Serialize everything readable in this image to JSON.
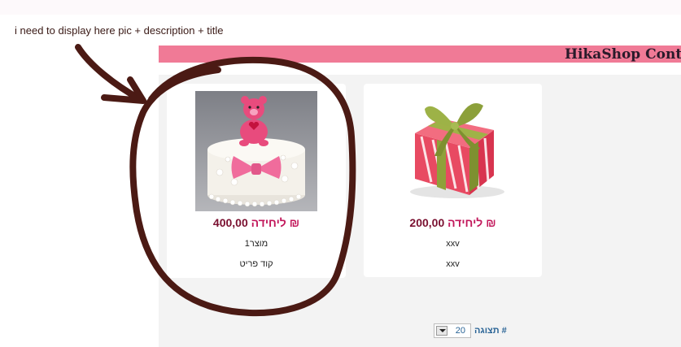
{
  "annotation": {
    "note": "i need to display here pic + description + title"
  },
  "header": {
    "title": "HikaShop Conte"
  },
  "products": [
    {
      "image_icon": "cake-teddy-bear-image",
      "price_amount": "400,00",
      "price_unit": "₪ ליחידה",
      "line1": "מוצר1",
      "line2": "קוד פריט"
    },
    {
      "image_icon": "gift-box-image",
      "price_amount": "200,00",
      "price_unit": "₪ ליחידה",
      "line1": "xxv",
      "line2": "xxv"
    }
  ],
  "pagination": {
    "display_label": "# תצוגה",
    "per_page": "20"
  },
  "colors": {
    "header_bar": "#f07a96",
    "price": "#7a1030",
    "price_unit": "#c2185b",
    "link": "#2a6496"
  }
}
